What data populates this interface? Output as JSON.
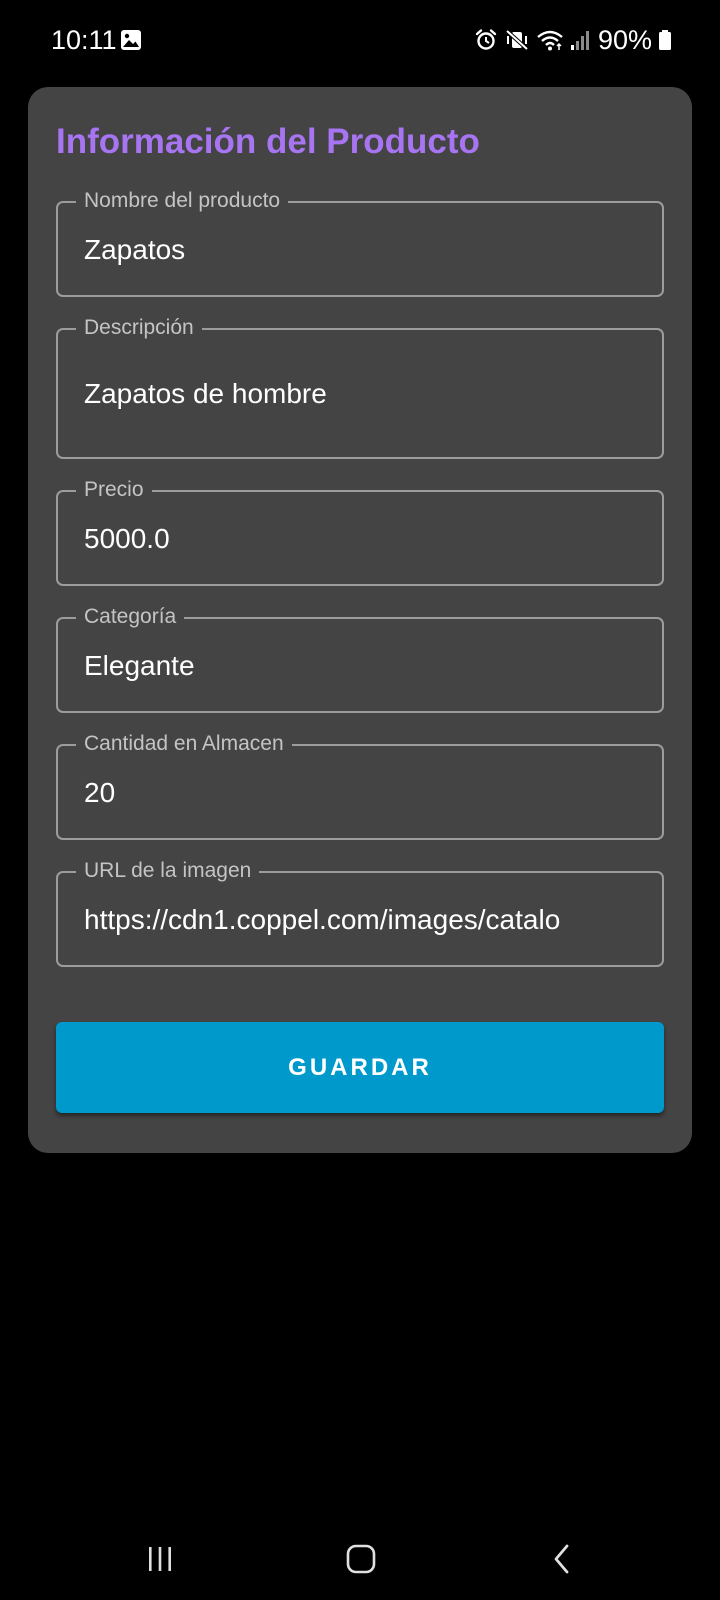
{
  "status_bar": {
    "time": "10:11",
    "battery": "90%",
    "icons": [
      "gallery-icon",
      "alarm-icon",
      "mute-vibrate-icon",
      "wifi-icon",
      "signal-icon",
      "battery-icon"
    ]
  },
  "form": {
    "title": "Información del Producto",
    "fields": [
      {
        "label": "Nombre del producto",
        "value": "Zapatos"
      },
      {
        "label": "Descripción",
        "value": "Zapatos de hombre"
      },
      {
        "label": "Precio",
        "value": "5000.0"
      },
      {
        "label": "Categoría",
        "value": "Elegante"
      },
      {
        "label": "Cantidad en Almacen",
        "value": "20"
      },
      {
        "label": "URL de la imagen",
        "value": "https://cdn1.coppel.com/images/catalo"
      }
    ],
    "save_label": "GUARDAR"
  },
  "nav_bar": {
    "icons": [
      "recent-apps-icon",
      "home-icon",
      "back-icon"
    ]
  },
  "colors": {
    "background": "#000000",
    "card": "#444444",
    "title": "#a774f2",
    "button": "#0099cc",
    "field_border": "#9c9c9c",
    "label": "#c4c4c4"
  }
}
